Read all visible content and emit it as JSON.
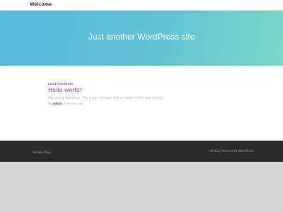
{
  "header": {
    "site_title": "Welcome"
  },
  "hero": {
    "tagline": "Just another WordPress site"
  },
  "post": {
    "category": "UNCATEGORIZED",
    "title": "Hello world!",
    "excerpt": "Welcome to WordPress. This is your first post. Edit or delete it, then start writing!",
    "meta_by": "By",
    "author": "admin",
    "date": "3 months ago"
  },
  "footer": {
    "menu_item": "Sample Page",
    "credit_theme": "Hestia",
    "credit_separator": " | Powered by ",
    "credit_platform": "WordPress"
  },
  "colors": {
    "hero_gradient_start": "#56b8dd",
    "hero_gradient_end": "#79d6c6",
    "accent_purple": "#9a34a4",
    "footer_bg": "#2b2b2b",
    "page_bg": "#d6d6d6"
  }
}
